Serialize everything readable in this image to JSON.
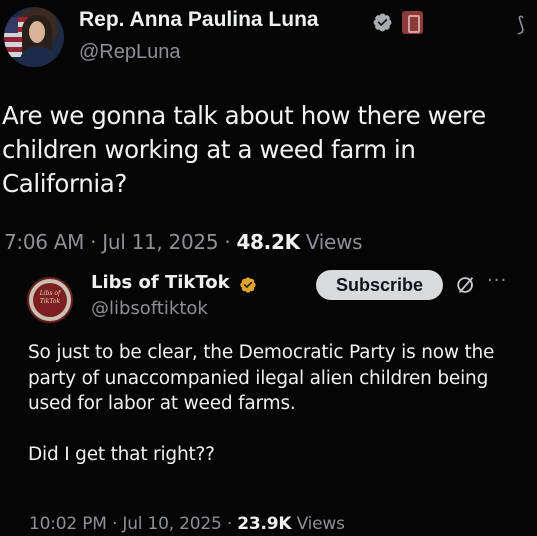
{
  "main_tweet": {
    "author_name": "Rep. Anna Paulina Luna",
    "handle": "@RepLuna",
    "text": "Are we gonna talk about how there were children working at a weed farm in California?",
    "time": "7:06 AM",
    "date": "Jul 11, 2025",
    "separator": "·",
    "views_count": "48.2K",
    "views_label": "Views"
  },
  "quoted_tweet": {
    "author_name": "Libs of TikTok",
    "handle": "@libsoftiktok",
    "avatar_text": "Libs of TikTok",
    "subscribe_label": "Subscribe",
    "more_label": "···",
    "text_line1": "So just to be clear, the Democratic Party is now the party of unaccompanied ilegal alien children being used for labor at weed farms.",
    "text_line2": "Did I get that right??",
    "time": "10:02 PM",
    "date": "Jul 10, 2025",
    "separator": "·",
    "views_count": "23.9K",
    "views_label": "Views"
  },
  "colors": {
    "background": "#050505",
    "text_primary": "#eef0f1",
    "text_secondary": "#8b9197",
    "verified_badge": "#9aa0a6",
    "subscribe_bg": "#d8dadc"
  },
  "icons": [
    "verified-badge-icon",
    "government-badge-icon",
    "grok-icon",
    "more-icon"
  ]
}
